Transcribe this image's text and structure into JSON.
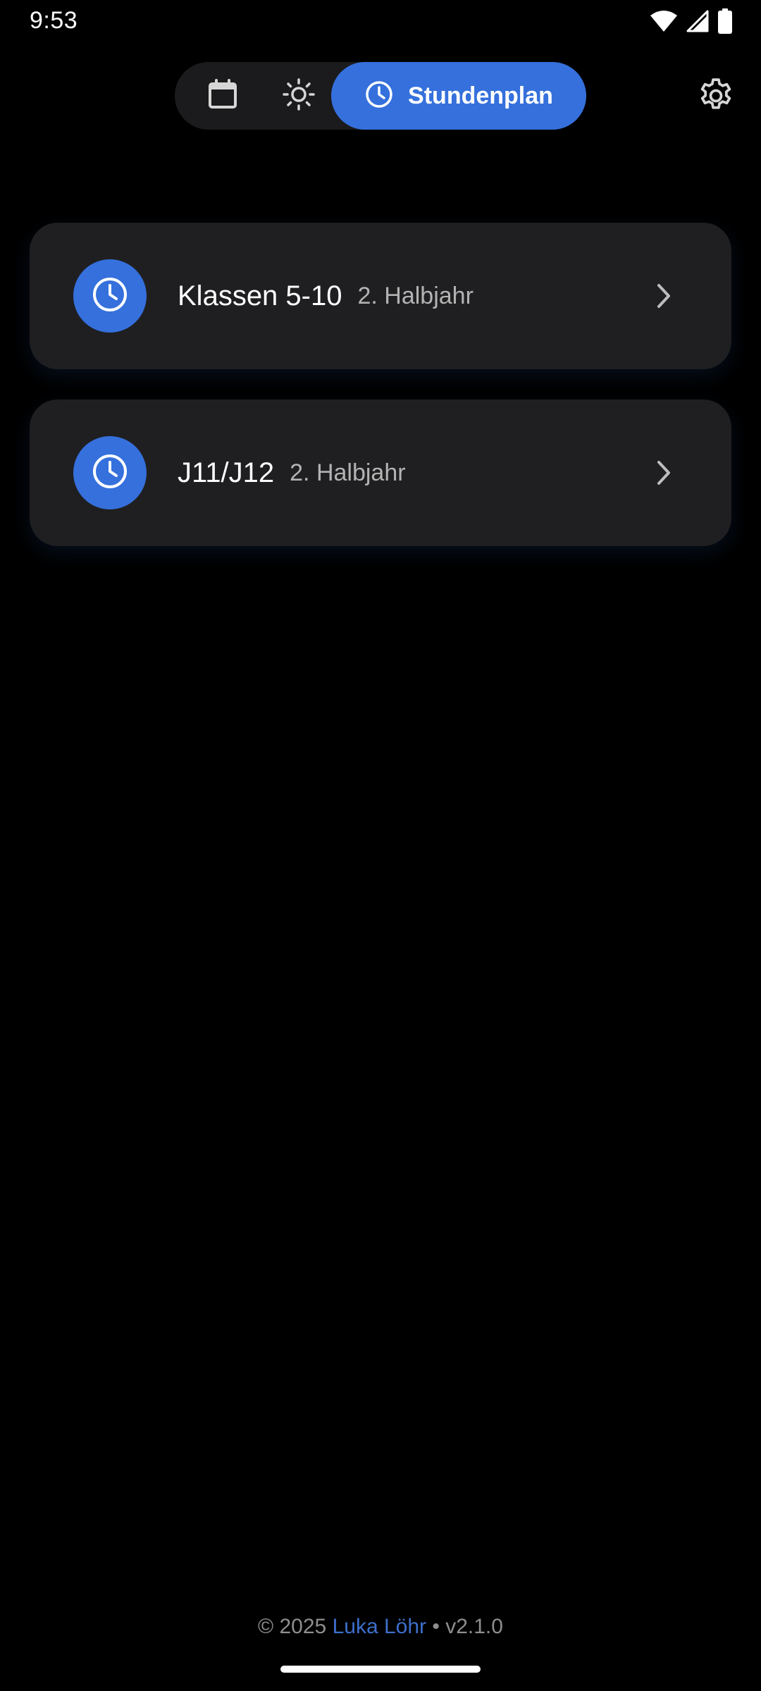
{
  "status_bar": {
    "time": "9:53",
    "icons": [
      "wifi-icon",
      "cellular-signal-icon",
      "battery-icon"
    ]
  },
  "top_nav": {
    "items": [
      {
        "icon": "calendar-icon",
        "label": "",
        "active": false
      },
      {
        "icon": "sun-icon",
        "label": "",
        "active": false
      },
      {
        "icon": "clock-icon",
        "label": "Stundenplan",
        "active": true
      }
    ],
    "settings_icon": "gear-icon"
  },
  "timetables": [
    {
      "title": "Klassen 5-10",
      "subtitle": "2. Halbjahr",
      "icon": "clock-icon"
    },
    {
      "title": "J11/J12",
      "subtitle": "2. Halbjahr",
      "icon": "clock-icon"
    }
  ],
  "footer": {
    "copyright": "© 2025",
    "author": "Luka Löhr",
    "separator": "•",
    "version": "v2.1.0"
  },
  "colors": {
    "accent": "#3570dc",
    "background": "#000000",
    "card": "#1f1f21",
    "segmented_bg": "#1b1b1d",
    "subtitle": "#b3b3b3",
    "author_link": "#3d6fcc"
  }
}
